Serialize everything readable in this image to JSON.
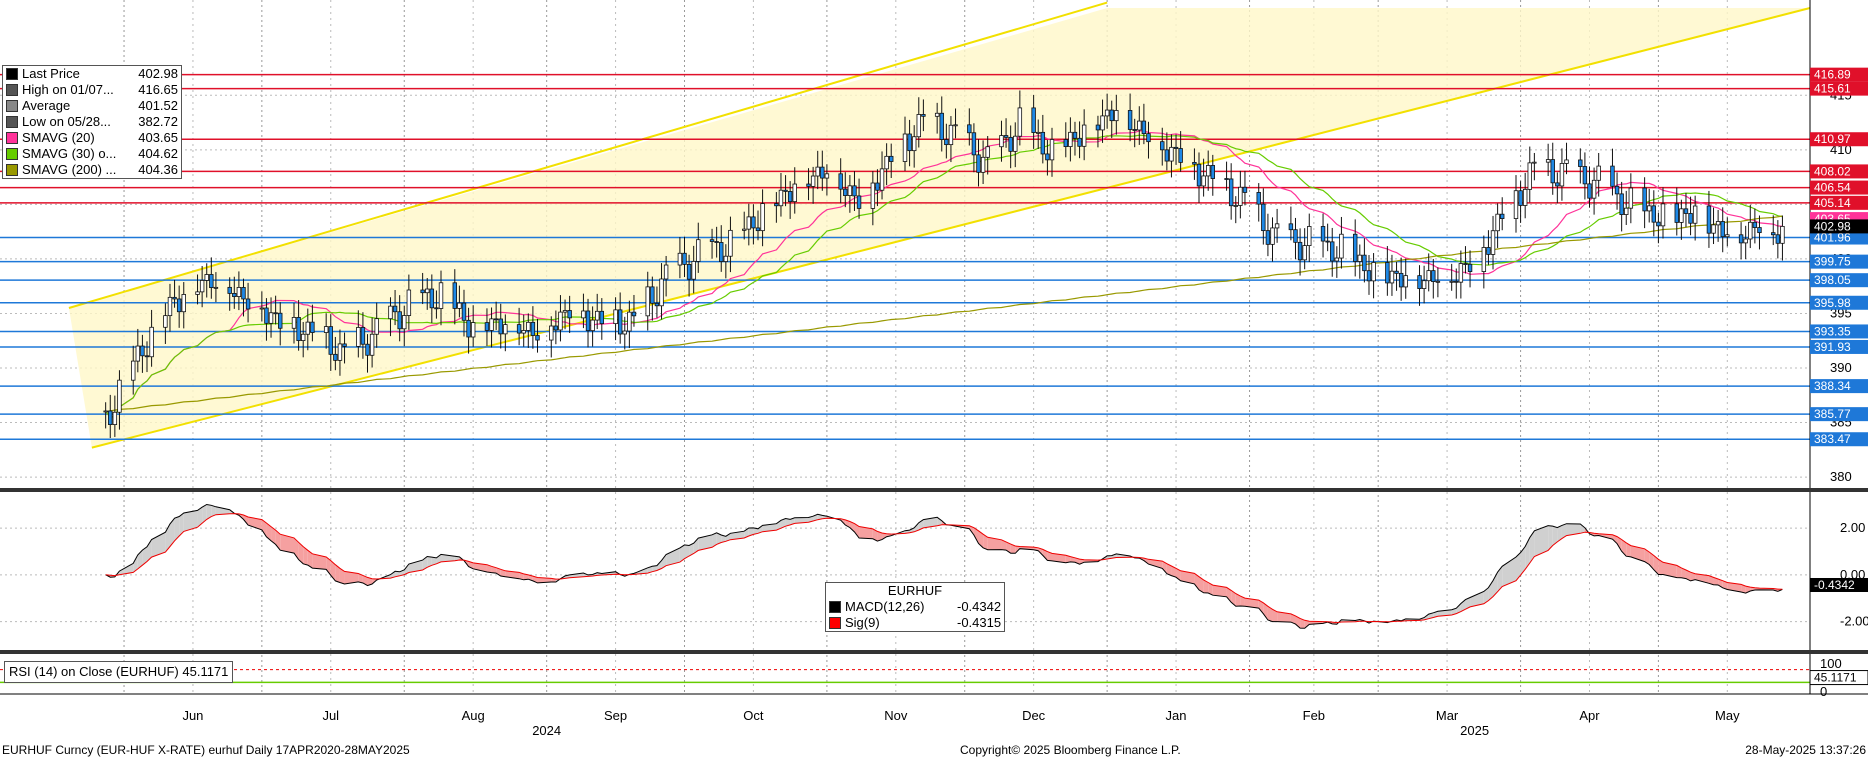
{
  "chart_data": {
    "type": "candlestick",
    "title": "EURHUF Curncy (EUR-HUF X-RATE) eurhuf  Daily 17APR2020-28MAY2025",
    "copyright": "Copyright© 2025 Bloomberg Finance L.P.",
    "timestamp": "28-May-2025 13:37:26",
    "x_months": [
      "Jun",
      "Jul",
      "Aug",
      "Sep",
      "Oct",
      "Nov",
      "Dec",
      "Jan",
      "Feb",
      "Mar",
      "Apr",
      "May"
    ],
    "x_years": [
      "2024",
      "2025"
    ],
    "price_axis": {
      "ylim": [
        379,
        423
      ],
      "ticks": [
        380,
        385,
        390,
        395,
        400,
        405,
        410,
        415
      ]
    },
    "legend": [
      {
        "label": "Last Price",
        "value": "402.98",
        "color": "#000000"
      },
      {
        "label": "High on 01/07...",
        "value": "416.65",
        "color": "#555555"
      },
      {
        "label": "Average",
        "value": "401.52",
        "color": "#888888"
      },
      {
        "label": "Low on 05/28...",
        "value": "382.72",
        "color": "#555555"
      },
      {
        "label": "SMAVG (20)",
        "value": "403.65",
        "color": "#ff3399"
      },
      {
        "label": "SMAVG (30)  o...",
        "value": "404.62",
        "color": "#66cc00"
      },
      {
        "label": "SMAVG (200)  ...",
        "value": "404.36",
        "color": "#999900"
      }
    ],
    "resistance_levels": [
      "416.89",
      "415.61",
      "410.97",
      "408.02",
      "406.54",
      "405.14"
    ],
    "support_levels": [
      "401.96",
      "399.75",
      "398.05",
      "395.98",
      "393.35",
      "391.93",
      "388.34",
      "385.77",
      "383.47"
    ],
    "last_price_badge": "402.98",
    "hidden_badge": "403.65",
    "close_series": [
      {
        "x": "2024-05-28",
        "y": 385.5
      },
      {
        "x": "2024-06-05",
        "y": 392.0
      },
      {
        "x": "2024-06-12",
        "y": 396.5
      },
      {
        "x": "2024-06-20",
        "y": 398.5
      },
      {
        "x": "2024-06-28",
        "y": 396.5
      },
      {
        "x": "2024-07-05",
        "y": 394.5
      },
      {
        "x": "2024-07-12",
        "y": 393.5
      },
      {
        "x": "2024-07-19",
        "y": 391.5
      },
      {
        "x": "2024-07-26",
        "y": 393.5
      },
      {
        "x": "2024-08-02",
        "y": 396.0
      },
      {
        "x": "2024-08-09",
        "y": 397.0
      },
      {
        "x": "2024-08-16",
        "y": 394.0
      },
      {
        "x": "2024-08-23",
        "y": 394.5
      },
      {
        "x": "2024-08-30",
        "y": 393.5
      },
      {
        "x": "2024-09-06",
        "y": 395.5
      },
      {
        "x": "2024-09-13",
        "y": 394.5
      },
      {
        "x": "2024-09-20",
        "y": 394.5
      },
      {
        "x": "2024-09-27",
        "y": 398.5
      },
      {
        "x": "2024-10-04",
        "y": 400.5
      },
      {
        "x": "2024-10-11",
        "y": 401.5
      },
      {
        "x": "2024-10-18",
        "y": 404.5
      },
      {
        "x": "2024-10-25",
        "y": 407.0
      },
      {
        "x": "2024-11-01",
        "y": 408.5
      },
      {
        "x": "2024-11-08",
        "y": 405.5
      },
      {
        "x": "2024-11-15",
        "y": 409.5
      },
      {
        "x": "2024-11-22",
        "y": 413.0
      },
      {
        "x": "2024-11-29",
        "y": 411.5
      },
      {
        "x": "2024-12-06",
        "y": 409.0
      },
      {
        "x": "2024-12-13",
        "y": 412.5
      },
      {
        "x": "2024-12-20",
        "y": 410.0
      },
      {
        "x": "2024-12-27",
        "y": 412.0
      },
      {
        "x": "2025-01-03",
        "y": 414.0
      },
      {
        "x": "2025-01-10",
        "y": 411.5
      },
      {
        "x": "2025-01-17",
        "y": 409.5
      },
      {
        "x": "2025-01-24",
        "y": 407.5
      },
      {
        "x": "2025-01-31",
        "y": 405.5
      },
      {
        "x": "2025-02-07",
        "y": 402.0
      },
      {
        "x": "2025-02-14",
        "y": 401.5
      },
      {
        "x": "2025-02-21",
        "y": 401.0
      },
      {
        "x": "2025-02-28",
        "y": 399.0
      },
      {
        "x": "2025-03-07",
        "y": 398.5
      },
      {
        "x": "2025-03-14",
        "y": 398.5
      },
      {
        "x": "2025-03-21",
        "y": 399.5
      },
      {
        "x": "2025-03-28",
        "y": 404.0
      },
      {
        "x": "2025-04-04",
        "y": 408.5
      },
      {
        "x": "2025-04-11",
        "y": 408.0
      },
      {
        "x": "2025-04-18",
        "y": 407.0
      },
      {
        "x": "2025-04-25",
        "y": 405.0
      },
      {
        "x": "2025-05-02",
        "y": 404.0
      },
      {
        "x": "2025-05-09",
        "y": 404.5
      },
      {
        "x": "2025-05-16",
        "y": 402.5
      },
      {
        "x": "2025-05-23",
        "y": 403.0
      },
      {
        "x": "2025-05-28",
        "y": 402.98
      }
    ],
    "macd_panel": {
      "title": "EURHUF",
      "ylim": [
        -3,
        3.2
      ],
      "ticks": [
        "2.00",
        "0.00",
        "-2.00"
      ],
      "current_badge": "-0.4342",
      "legend": [
        {
          "label": "MACD(12,26)",
          "value": "-0.4342",
          "color": "#000000"
        },
        {
          "label": "Sig(9)",
          "value": "-0.4315",
          "color": "#ff0000"
        }
      ]
    },
    "rsi_panel": {
      "label": "RSI (14)  on Close (EURHUF) 45.1171",
      "ticks": [
        "100",
        "0"
      ],
      "current_badge": "45.1171",
      "overbought": 70,
      "oversold": 30,
      "value": 45.1171
    }
  }
}
